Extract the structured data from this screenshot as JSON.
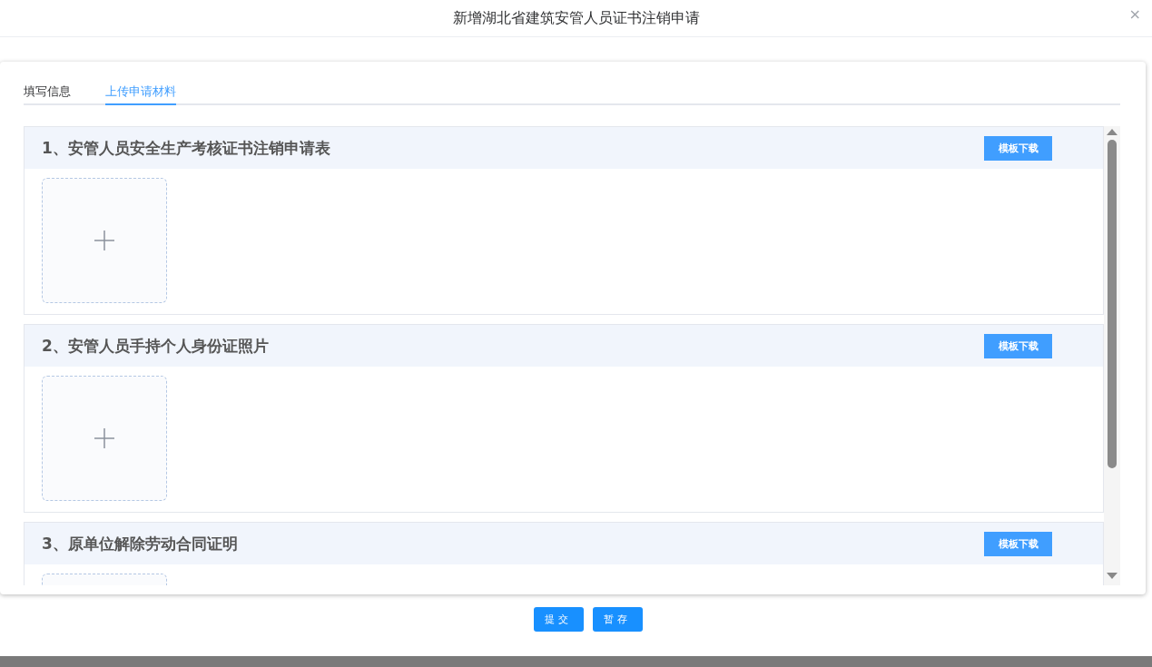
{
  "dialog": {
    "title": "新增湖北省建筑安管人员证书注销申请",
    "close": "×"
  },
  "tabs": [
    {
      "label": "填写信息",
      "selected": false
    },
    {
      "label": "上传申请材料",
      "selected": true
    }
  ],
  "sections": [
    {
      "title": "1、安管人员安全生产考核证书注销申请表",
      "button": "模板下载"
    },
    {
      "title": "2、安管人员手持个人身份证照片",
      "button": "模板下载"
    },
    {
      "title": "3、原单位解除劳动合同证明",
      "button": "模板下载"
    }
  ],
  "buttons": [
    "提交",
    "暂存"
  ]
}
